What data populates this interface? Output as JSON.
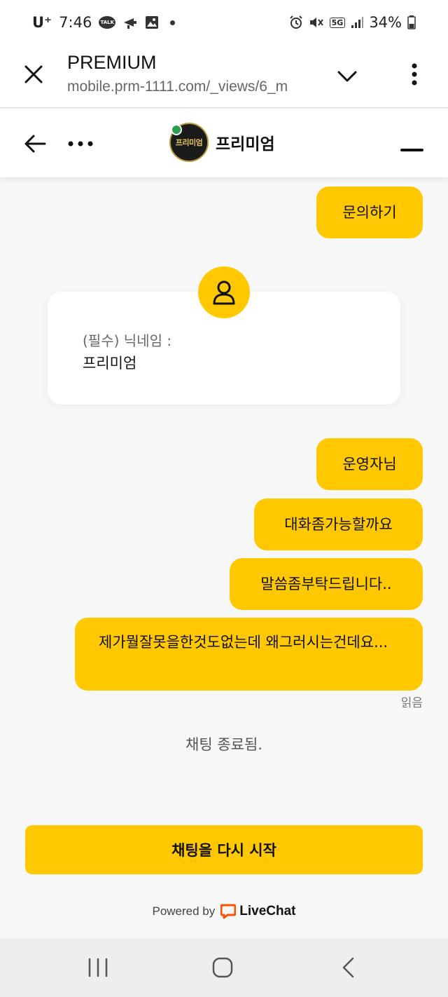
{
  "status_bar": {
    "carrier": "U⁺",
    "time": "7:46",
    "talk_icon_text": "TALK",
    "network": "5G",
    "battery": "34%"
  },
  "browser": {
    "title": "PREMIUM",
    "url": "mobile.prm-1111.com/_views/6_m"
  },
  "chat_header": {
    "brand_name": "프리미엄",
    "avatar_text": "프리미엄"
  },
  "messages": [
    {
      "text": "문의하기"
    },
    {
      "text": "운영자님"
    },
    {
      "text": "대화좀가능할까요"
    },
    {
      "text": "말씀좀부탁드립니다.."
    },
    {
      "text": "제가뭘잘못을한것도없는데 왜그러시는건데요..."
    }
  ],
  "form": {
    "label": "(필수) 닉네임 :",
    "value": "프리미엄"
  },
  "read_receipt": "읽음",
  "chat_ended": "채팅 종료됨.",
  "restart_button": "채팅을 다시 시작",
  "powered_by": {
    "prefix": "Powered by",
    "brand": "LiveChat"
  },
  "colors": {
    "accent": "#ffc800",
    "livechat": "#ff5100",
    "online": "#2e9e4f"
  }
}
